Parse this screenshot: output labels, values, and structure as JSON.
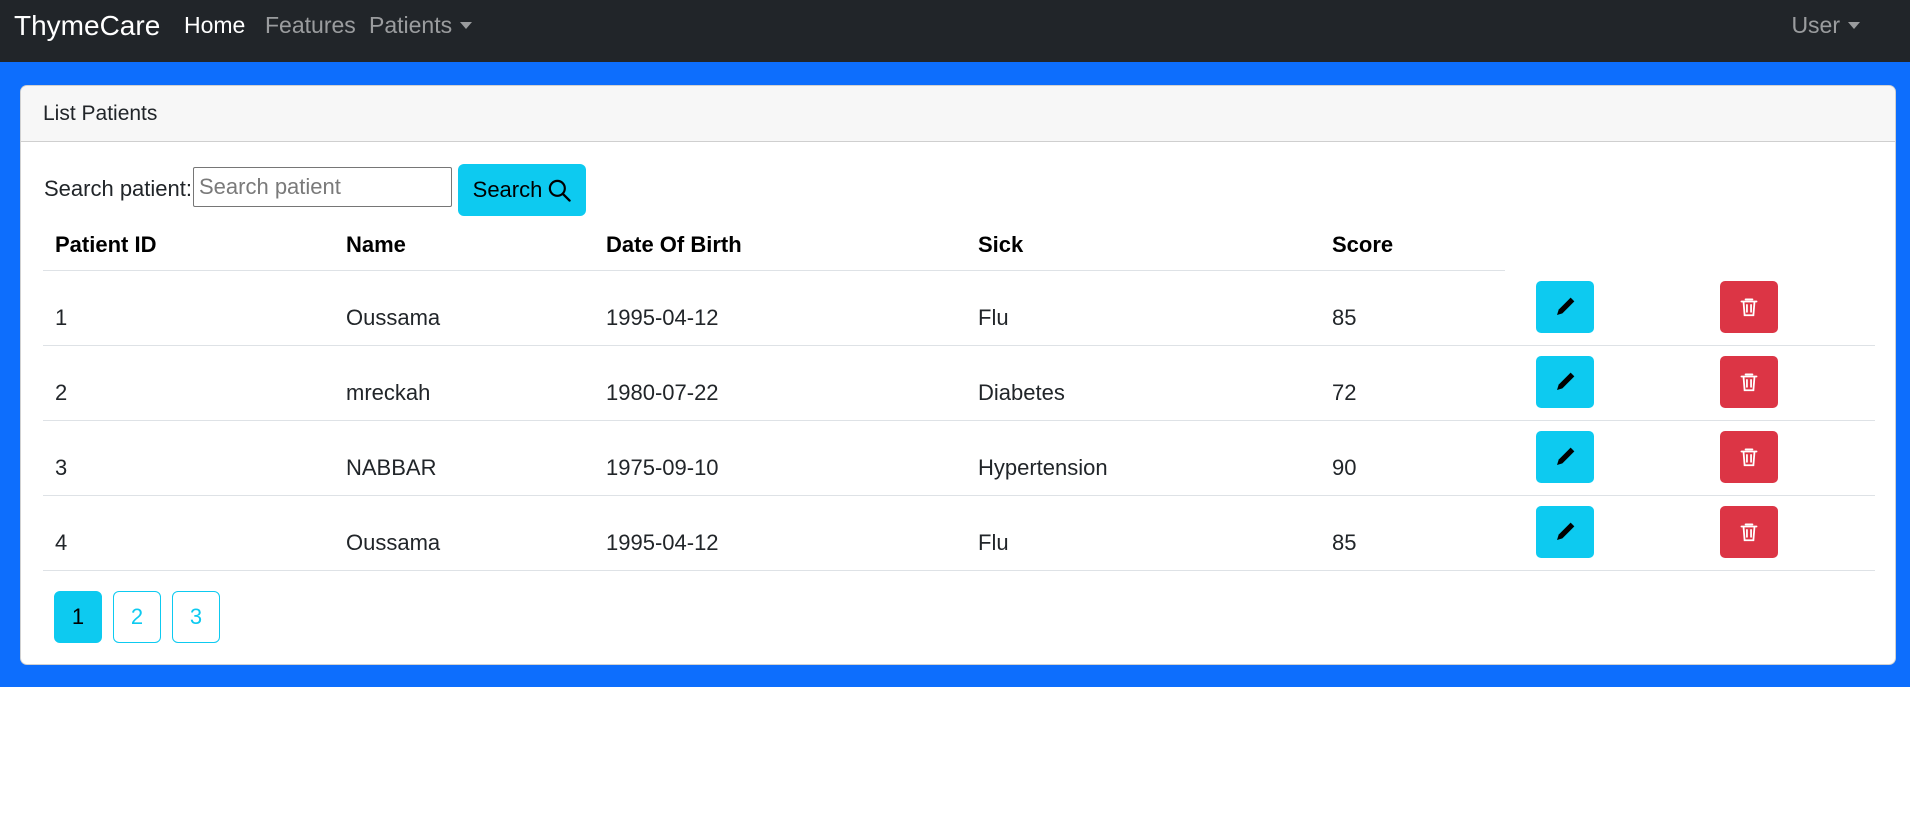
{
  "navbar": {
    "brand": "ThymeCare",
    "items": [
      {
        "label": "Home"
      },
      {
        "label": "Features"
      },
      {
        "label": "Patients"
      }
    ],
    "user_label": "User"
  },
  "card": {
    "title": "List Patients",
    "search": {
      "label": "Search patient:",
      "placeholder": "Search patient",
      "value": "",
      "button_label": "Search"
    },
    "table": {
      "columns": [
        "Patient ID",
        "Name",
        "Date Of Birth",
        "Sick",
        "Score"
      ],
      "rows": [
        {
          "id": "1",
          "name": "Oussama",
          "dob": "1995-04-12",
          "sick": "Flu",
          "score": "85"
        },
        {
          "id": "2",
          "name": "mreckah",
          "dob": "1980-07-22",
          "sick": "Diabetes",
          "score": "72"
        },
        {
          "id": "3",
          "name": "NABBAR",
          "dob": "1975-09-10",
          "sick": "Hypertension",
          "score": "90"
        },
        {
          "id": "4",
          "name": "Oussama",
          "dob": "1995-04-12",
          "sick": "Flu",
          "score": "85"
        }
      ]
    },
    "pagination": {
      "pages": [
        "1",
        "2",
        "3"
      ],
      "current": "1"
    }
  },
  "colors": {
    "navbar_bg": "#212529",
    "band_bg": "#0d6efd",
    "info": "#0dcaf0",
    "danger": "#dc3545"
  },
  "icons": {
    "search": "search-icon",
    "edit": "pencil-icon",
    "delete": "trash-icon"
  }
}
